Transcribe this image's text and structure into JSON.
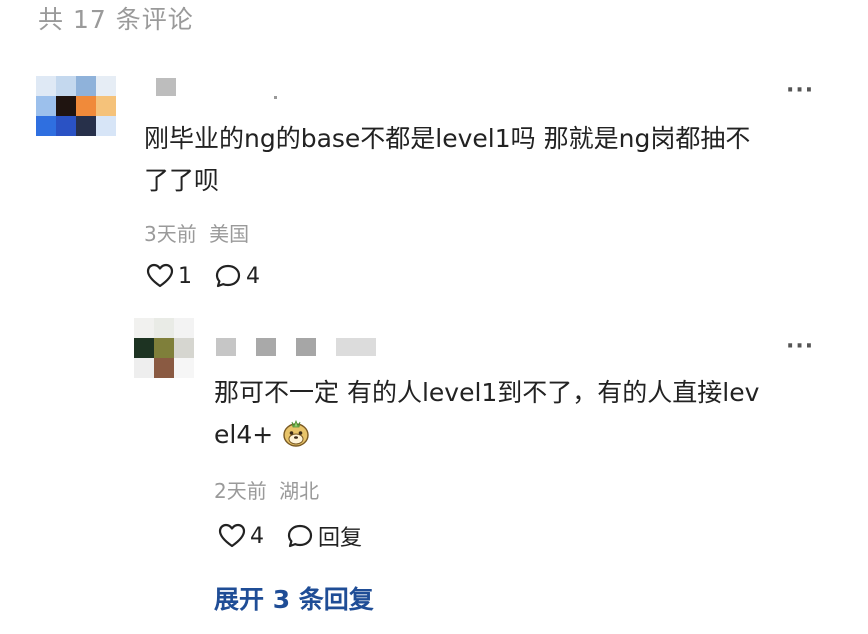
{
  "header": {
    "comment_count_label": "共 17 条评论"
  },
  "comments": [
    {
      "text_line1": "刚毕业的ng的base不都是level1吗 那就是ng岗都抽不",
      "text_line2": "了了呗",
      "time": "3天前",
      "location": "美国",
      "likes": "1",
      "replies": "4",
      "more_label": "···"
    },
    {
      "text_line1": "那可不一定 有的人level1到不了，有的人直接lev",
      "text_line2": "el4+",
      "time": "2天前",
      "location": "湖北",
      "likes": "4",
      "reply_label": "回复",
      "more_label": "···"
    }
  ],
  "expand_label": "展开 3 条回复",
  "icons": {
    "like": "heart-icon",
    "comment": "comment-bubble-icon",
    "more": "more-dots-icon",
    "emoji": "doge-emoji-icon"
  }
}
